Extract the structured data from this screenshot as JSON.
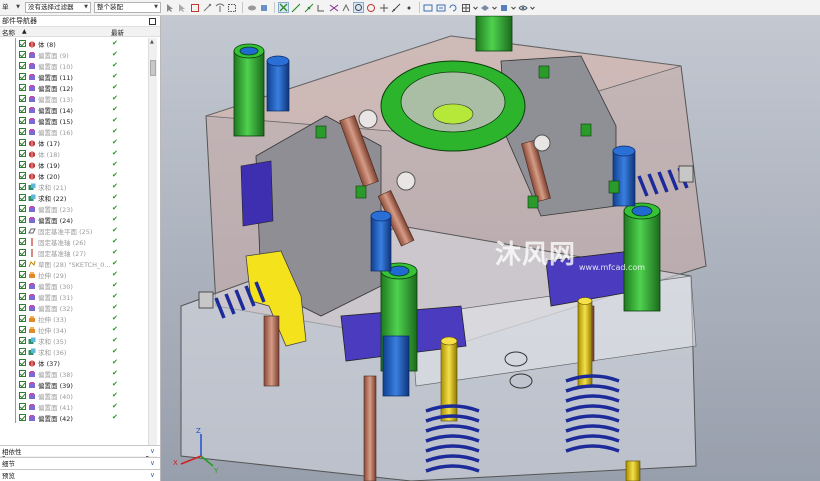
{
  "toolbar": {
    "menu_label": "单",
    "filter": "没有选择过滤器",
    "scope": "整个装配"
  },
  "navigator": {
    "title": "部件导航器",
    "col_name": "名称",
    "col_latest": "最新",
    "rows": [
      {
        "label": "体 (8)",
        "icon": "solid-body-icon",
        "grey": false
      },
      {
        "label": "偏置面 (9)",
        "icon": "offset-face-icon",
        "grey": true
      },
      {
        "label": "偏置面 (10)",
        "icon": "offset-face-icon",
        "grey": true
      },
      {
        "label": "偏置面 (11)",
        "icon": "offset-face-icon",
        "grey": false
      },
      {
        "label": "偏置面 (12)",
        "icon": "offset-face-icon",
        "grey": false
      },
      {
        "label": "偏置面 (13)",
        "icon": "offset-face-icon",
        "grey": true
      },
      {
        "label": "偏置面 (14)",
        "icon": "offset-face-icon",
        "grey": false
      },
      {
        "label": "偏置面 (15)",
        "icon": "offset-face-icon",
        "grey": false
      },
      {
        "label": "偏置面 (16)",
        "icon": "offset-face-icon",
        "grey": true
      },
      {
        "label": "体 (17)",
        "icon": "solid-body-icon",
        "grey": false
      },
      {
        "label": "体 (18)",
        "icon": "solid-body-icon",
        "grey": true
      },
      {
        "label": "体 (19)",
        "icon": "solid-body-icon",
        "grey": false
      },
      {
        "label": "体 (20)",
        "icon": "solid-body-icon",
        "grey": false
      },
      {
        "label": "求和 (21)",
        "icon": "unite-icon",
        "grey": true
      },
      {
        "label": "求和 (22)",
        "icon": "unite-icon",
        "grey": false
      },
      {
        "label": "偏置面 (23)",
        "icon": "offset-face-icon",
        "grey": true
      },
      {
        "label": "偏置面 (24)",
        "icon": "offset-face-icon",
        "grey": false
      },
      {
        "label": "固定基准平面 (25)",
        "icon": "datum-plane-icon",
        "grey": true
      },
      {
        "label": "固定基准轴 (26)",
        "icon": "datum-axis-icon",
        "grey": true
      },
      {
        "label": "固定基准轴 (27)",
        "icon": "datum-axis-icon",
        "grey": true
      },
      {
        "label": "草图 (28) \"SKETCH_0...",
        "icon": "sketch-icon",
        "grey": true
      },
      {
        "label": "拉伸 (29)",
        "icon": "extrude-icon",
        "grey": true
      },
      {
        "label": "偏置面 (30)",
        "icon": "offset-face-icon",
        "grey": true
      },
      {
        "label": "偏置面 (31)",
        "icon": "offset-face-icon",
        "grey": true
      },
      {
        "label": "偏置面 (32)",
        "icon": "offset-face-icon",
        "grey": true
      },
      {
        "label": "拉伸 (33)",
        "icon": "extrude-icon",
        "grey": true
      },
      {
        "label": "拉伸 (34)",
        "icon": "extrude-icon",
        "grey": true
      },
      {
        "label": "求和 (35)",
        "icon": "unite-icon",
        "grey": true
      },
      {
        "label": "求和 (36)",
        "icon": "unite-icon",
        "grey": true
      },
      {
        "label": "体 (37)",
        "icon": "solid-body-icon",
        "grey": false
      },
      {
        "label": "偏置面 (38)",
        "icon": "offset-face-icon",
        "grey": true
      },
      {
        "label": "偏置面 (39)",
        "icon": "offset-face-icon",
        "grey": false
      },
      {
        "label": "偏置面 (40)",
        "icon": "offset-face-icon",
        "grey": true
      },
      {
        "label": "偏置面 (41)",
        "icon": "offset-face-icon",
        "grey": true
      },
      {
        "label": "偏置面 (42)",
        "icon": "offset-face-icon",
        "grey": false
      }
    ],
    "latest_mark": "✔"
  },
  "panels": {
    "dependencies": "相依性",
    "details": "细节",
    "preview": "预览"
  },
  "watermark": {
    "brand": "沐风网",
    "url": "www.mfcad.com"
  },
  "colors": {
    "viewport_bg": "#aeb4bf",
    "check_green": "#1b9a1b",
    "panel_chevron": "#3d6fb0"
  }
}
